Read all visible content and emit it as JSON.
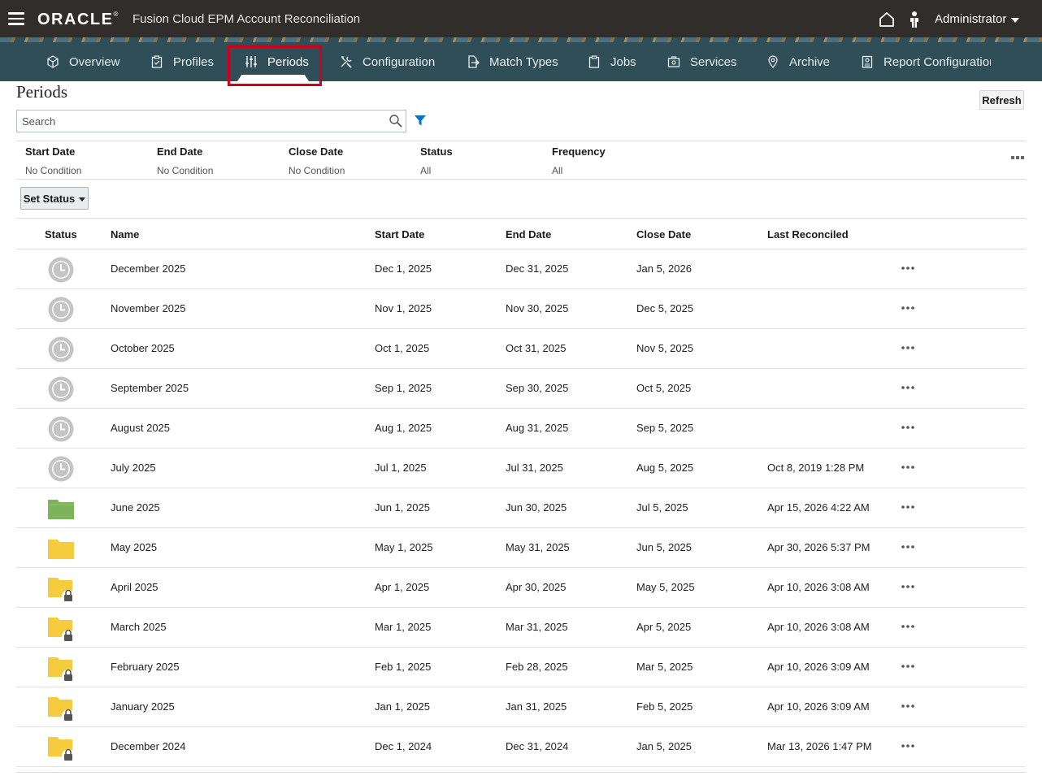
{
  "header": {
    "logo": "ORACLE",
    "app_title": "Fusion Cloud EPM Account Reconciliation",
    "user": "Administrator"
  },
  "nav": {
    "items": [
      {
        "label": "Overview",
        "icon": "cube-icon"
      },
      {
        "label": "Profiles",
        "icon": "clipboard-check-icon"
      },
      {
        "label": "Periods",
        "icon": "sliders-icon",
        "active": true
      },
      {
        "label": "Configuration",
        "icon": "tools-icon"
      },
      {
        "label": "Match Types",
        "icon": "document-arrow-icon"
      },
      {
        "label": "Jobs",
        "icon": "clipboard-icon"
      },
      {
        "label": "Services",
        "icon": "briefcase-icon"
      },
      {
        "label": "Archive",
        "icon": "location-pin-icon"
      },
      {
        "label": "Report Configuratior",
        "icon": "report-icon"
      }
    ]
  },
  "page": {
    "title": "Periods",
    "refresh_label": "Refresh",
    "search_placeholder": "Search",
    "set_status_label": "Set Status"
  },
  "filters": [
    {
      "label": "Start Date",
      "value": "No Condition"
    },
    {
      "label": "End Date",
      "value": "No Condition"
    },
    {
      "label": "Close Date",
      "value": "No Condition"
    },
    {
      "label": "Status",
      "value": "All"
    },
    {
      "label": "Frequency",
      "value": "All"
    }
  ],
  "table": {
    "columns": [
      "Status",
      "Name",
      "Start Date",
      "End Date",
      "Close Date",
      "Last Reconciled"
    ],
    "rows": [
      {
        "status": "pending",
        "name": "December 2025",
        "start": "Dec 1, 2025",
        "end": "Dec 31, 2025",
        "close": "Jan 5, 2026",
        "last": ""
      },
      {
        "status": "pending",
        "name": "November 2025",
        "start": "Nov 1, 2025",
        "end": "Nov 30, 2025",
        "close": "Dec 5, 2025",
        "last": ""
      },
      {
        "status": "pending",
        "name": "October 2025",
        "start": "Oct 1, 2025",
        "end": "Oct 31, 2025",
        "close": "Nov 5, 2025",
        "last": ""
      },
      {
        "status": "pending",
        "name": "September 2025",
        "start": "Sep 1, 2025",
        "end": "Sep 30, 2025",
        "close": "Oct 5, 2025",
        "last": ""
      },
      {
        "status": "pending",
        "name": "August 2025",
        "start": "Aug 1, 2025",
        "end": "Aug 31, 2025",
        "close": "Sep 5, 2025",
        "last": ""
      },
      {
        "status": "pending",
        "name": "July 2025",
        "start": "Jul 1, 2025",
        "end": "Jul 31, 2025",
        "close": "Aug 5, 2025",
        "last": "Oct 8, 2019 1:28 PM"
      },
      {
        "status": "open",
        "name": "June 2025",
        "start": "Jun 1, 2025",
        "end": "Jun 30, 2025",
        "close": "Jul 5, 2025",
        "last": "Apr 15, 2026 4:22 AM"
      },
      {
        "status": "closed",
        "name": "May 2025",
        "start": "May 1, 2025",
        "end": "May 31, 2025",
        "close": "Jun 5, 2025",
        "last": "Apr 30, 2026 5:37 PM"
      },
      {
        "status": "locked",
        "name": "April 2025",
        "start": "Apr 1, 2025",
        "end": "Apr 30, 2025",
        "close": "May 5, 2025",
        "last": "Apr 10, 2026 3:08 AM"
      },
      {
        "status": "locked",
        "name": "March 2025",
        "start": "Mar 1, 2025",
        "end": "Mar 31, 2025",
        "close": "Apr 5, 2025",
        "last": "Apr 10, 2026 3:08 AM"
      },
      {
        "status": "locked",
        "name": "February 2025",
        "start": "Feb 1, 2025",
        "end": "Feb 28, 2025",
        "close": "Mar 5, 2025",
        "last": "Apr 10, 2026 3:09 AM"
      },
      {
        "status": "locked",
        "name": "January 2025",
        "start": "Jan 1, 2025",
        "end": "Jan 31, 2025",
        "close": "Feb 5, 2025",
        "last": "Apr 10, 2026 3:09 AM"
      },
      {
        "status": "locked",
        "name": "December 2024",
        "start": "Dec 1, 2024",
        "end": "Dec 31, 2024",
        "close": "Jan 5, 2025",
        "last": "Mar 13, 2026 1:47 PM"
      }
    ]
  },
  "colors": {
    "topbar": "#312d2a",
    "navbar": "#2f4e58",
    "highlight": "#d0021b",
    "open_folder": "#7cb35b",
    "closed_folder": "#f5cc3d",
    "pending_clock": "#c4c4c4",
    "filter_icon": "#0572ce"
  }
}
